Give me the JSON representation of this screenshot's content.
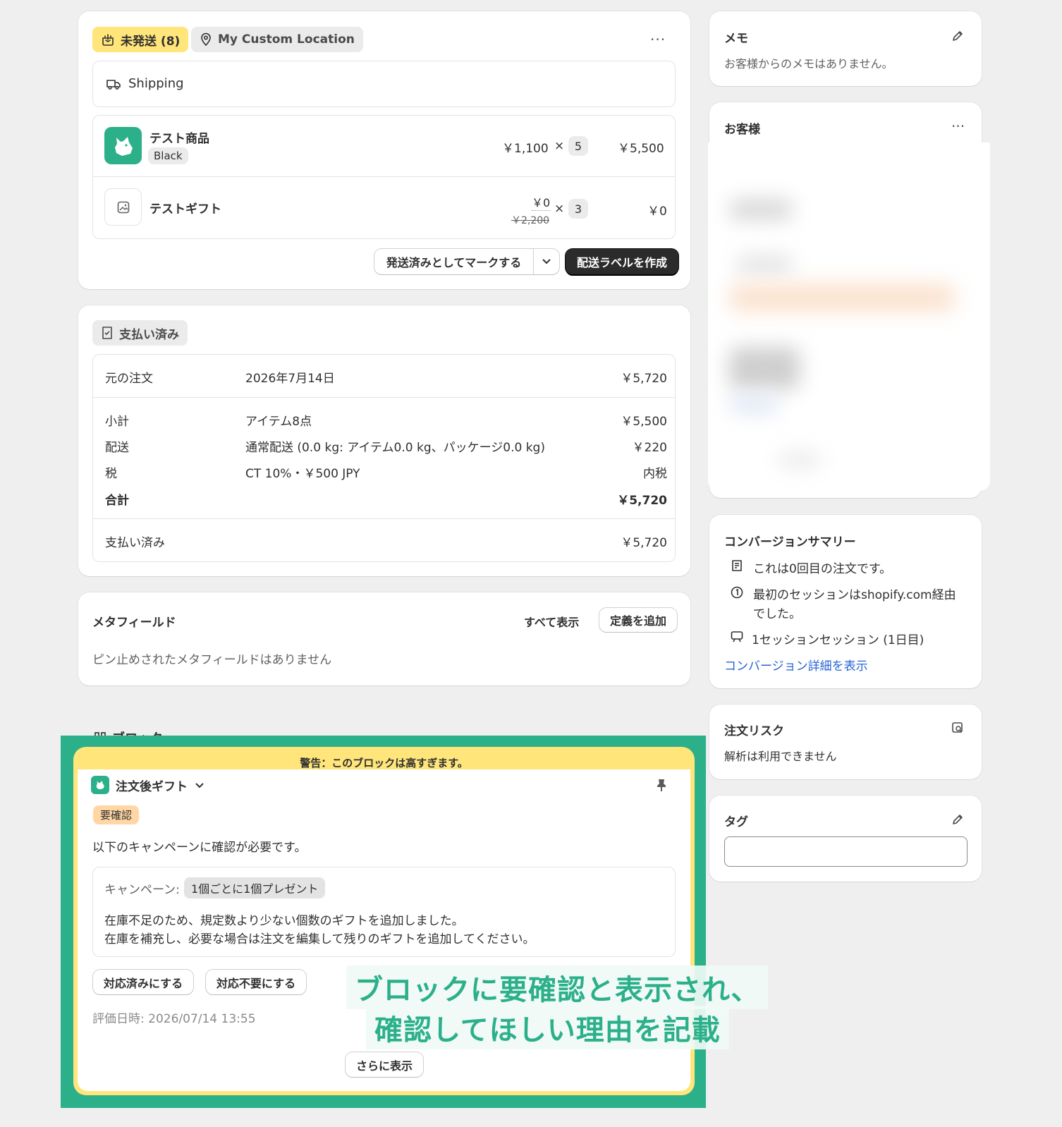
{
  "fulfillment": {
    "status_label": "未発送 (8)",
    "location_label": "My Custom Location",
    "method_label": "Shipping",
    "items": [
      {
        "name": "テスト商品",
        "variant": "Black",
        "unit_price": "￥1,100",
        "times": "×",
        "qty": "5",
        "total": "￥5,500"
      },
      {
        "name": "テストギフト",
        "unit_price": "￥0",
        "original_price": "￥2,200",
        "times": "×",
        "qty": "3",
        "total": "￥0"
      }
    ],
    "mark_fulfilled_label": "発送済みとしてマークする",
    "create_label_label": "配送ラベルを作成"
  },
  "payment": {
    "status_label": "支払い済み",
    "rows": [
      {
        "label": "元の注文",
        "detail": "2026年7月14日",
        "amount": "￥5,720"
      },
      {
        "label": "小計",
        "detail": "アイテム8点",
        "amount": "￥5,500"
      },
      {
        "label": "配送",
        "detail": "通常配送 (0.0 kg: アイテム0.0 kg、パッケージ0.0 kg)",
        "amount": "￥220"
      },
      {
        "label": "税",
        "detail": "CT 10%・￥500 JPY",
        "amount": "内税"
      },
      {
        "label": "合計",
        "detail": "",
        "amount": "￥5,720"
      },
      {
        "label": "支払い済み",
        "detail": "",
        "amount": "￥5,720"
      }
    ]
  },
  "metafields": {
    "title": "メタフィールド",
    "show_all_label": "すべて表示",
    "add_definition_label": "定義を追加",
    "empty_text": "ピン止めされたメタフィールドはありません"
  },
  "blocks": {
    "section_title": "ブロック",
    "warning": "警告：このブロックは高すぎます。",
    "app_name": "注文後ギフト",
    "badge": "要確認",
    "description": "以下のキャンペーンに確認が必要です。",
    "campaign_label": "キャンペーン:",
    "campaign_name": "1個ごとに1個プレゼント",
    "message_line1": "在庫不足のため、規定数より少ない個数のギフトを追加しました。",
    "message_line2": "在庫を補充し、必要な場合は注文を編集して残りのギフトを追加してください。",
    "resolve_label": "対応済みにする",
    "dismiss_label": "対応不要にする",
    "evaluated_at": "評価日時: 2026/07/14 13:55",
    "show_more_label": "さらに表示"
  },
  "annotation": {
    "line1": "ブロックに要確認と表示され、",
    "line2": "確認してほしい理由を記載",
    "color": "#2bb08a"
  },
  "sidebar": {
    "memo": {
      "title": "メモ",
      "text": "お客様からのメモはありません。"
    },
    "customer": {
      "title": "お客様"
    },
    "conversion": {
      "title": "コンバージョンサマリー",
      "line1": "これは0回目の注文です。",
      "line2a": "最初のセッションはshopify.com経由",
      "line2b": "でした。",
      "line3": "1セッションセッション (1日目)",
      "link": "コンバージョン詳細を表示"
    },
    "risk": {
      "title": "注文リスク",
      "text": "解析は利用できません"
    },
    "tags": {
      "title": "タグ",
      "value": ""
    }
  },
  "colors": {
    "unfulfilled_badge": "#ffe57a",
    "highlight_frame": "#2bb08a",
    "link": "#2563d4",
    "review_badge": "#ffd6a4"
  }
}
